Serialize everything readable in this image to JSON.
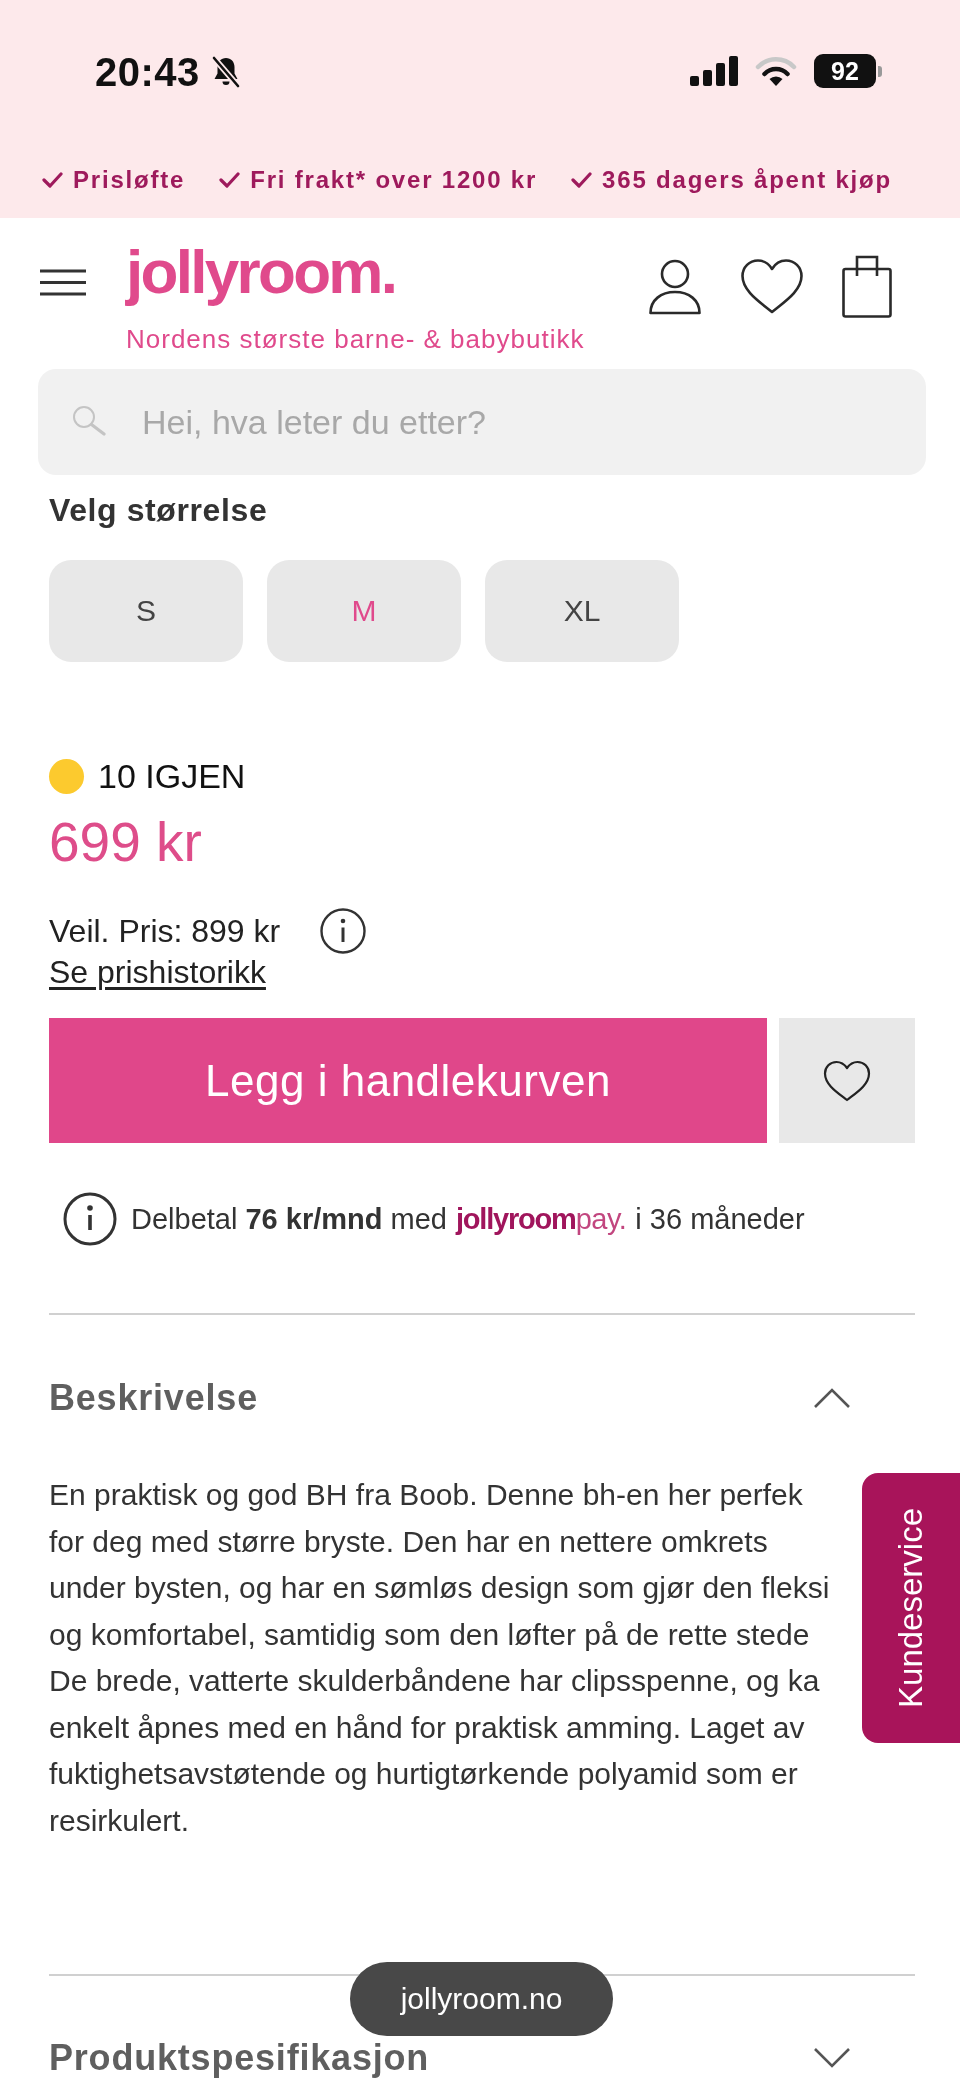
{
  "status_bar": {
    "time": "20:43",
    "silent": true,
    "battery": "92"
  },
  "promo_bar": {
    "items": [
      "Prisløfte",
      "Fri frakt* over 1200 kr",
      "365 dagers åpent kjøp"
    ]
  },
  "header": {
    "logo": "jollyroom.",
    "tagline": "Nordens største barne- & babybutikk"
  },
  "search": {
    "placeholder": "Hei, hva leter du etter?"
  },
  "size_picker": {
    "label": "Velg størrelse",
    "sizes": [
      {
        "label": "S",
        "selected": false
      },
      {
        "label": "M",
        "selected": true
      },
      {
        "label": "XL",
        "selected": false
      }
    ]
  },
  "stock": {
    "low_stock": true,
    "text": "10 IGJEN"
  },
  "price": {
    "current": "699 kr",
    "recommended": "Veil. Pris: 899 kr",
    "history_link": "Se prishistorikk"
  },
  "actions": {
    "add_to_cart": "Legg i handlekurven"
  },
  "installment": {
    "before": "Delbetal **76 kr/mnd** med",
    "logo": {
      "brand": "jollyroom",
      "suffix": "pay."
    },
    "after": "i 36 måneder"
  },
  "sections": [
    {
      "title": "Beskrivelse",
      "expanded": true,
      "lines": [
        "En praktisk og god BH fra Boob. Denne bh-en her perfek",
        "for deg med større bryste. Den har en nettere omkrets",
        "under bysten, og har en sømløs design som gjør den fleksi",
        "og komfortabel, samtidig som den løfter på de rette stede",
        "De brede, vatterte skulderbåndene har clipsspenne, og ka",
        "enkelt åpnes med en hånd for praktisk amming. Laget av",
        "fuktighetsavstøtende og hurtigtørkende polyamid som er",
        "resirkulert."
      ]
    },
    {
      "title": "Produktspesifikasjon",
      "expanded": false
    }
  ],
  "customer_service_tab": {
    "label": "Kundeservice"
  },
  "url_pill": {
    "text": "jollyroom.no"
  }
}
